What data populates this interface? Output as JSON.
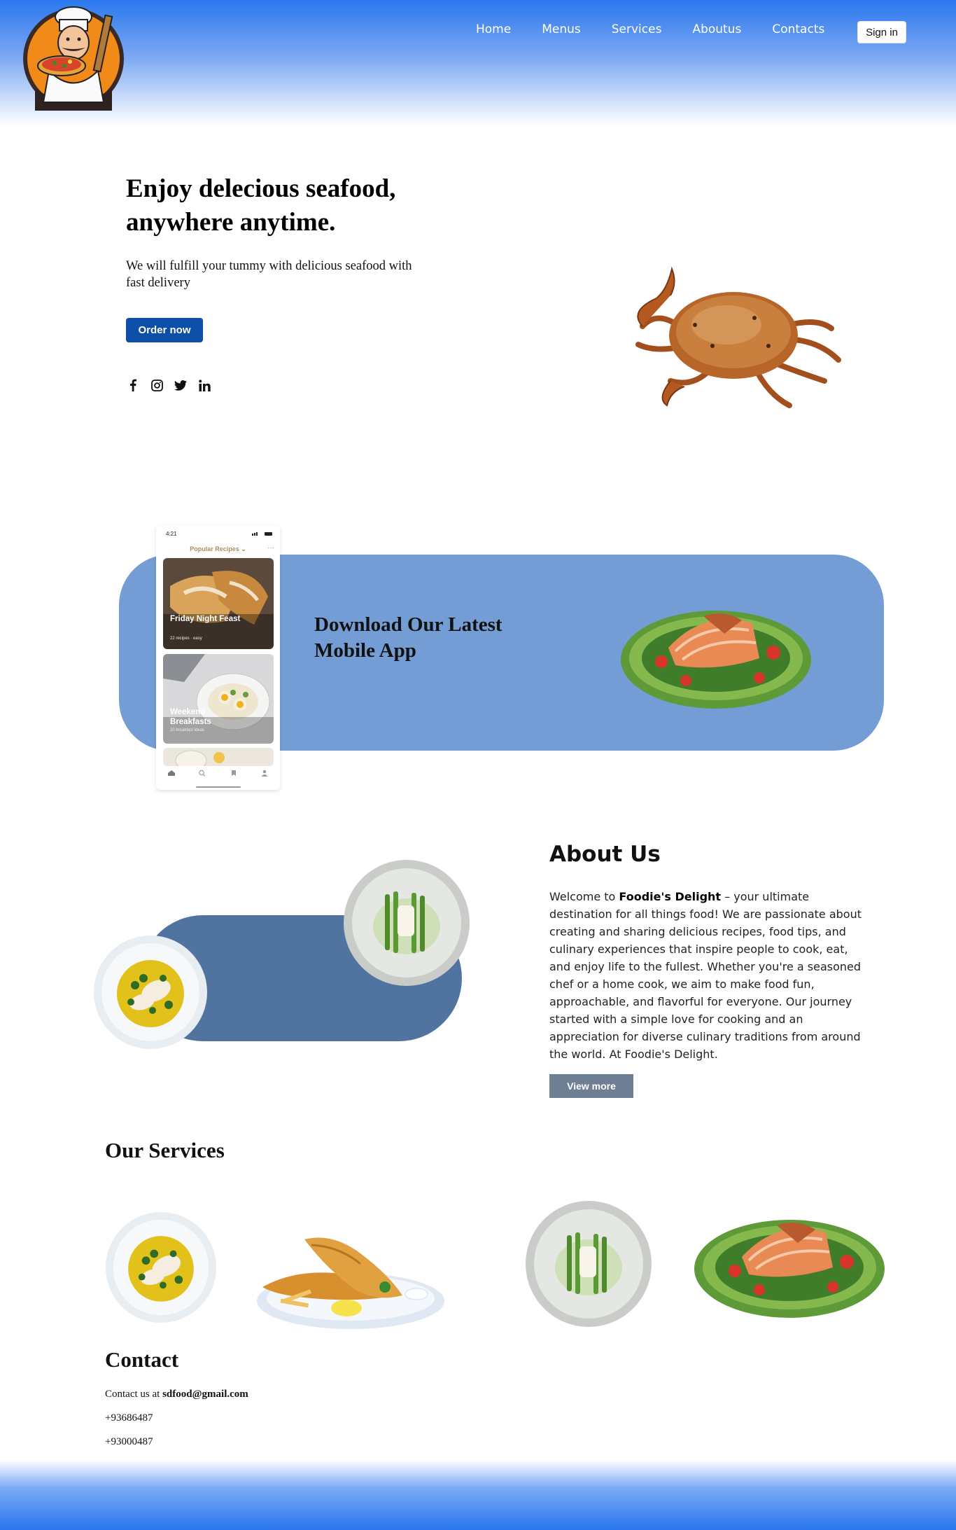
{
  "header": {
    "logo_icon": "chef-with-pizza-logo",
    "nav": [
      "Home",
      "Menus",
      "Services",
      "Aboutus",
      "Contacts"
    ],
    "sign_in": "Sign in"
  },
  "hero": {
    "title": "Enjoy delecious seafood, anywhere anytime.",
    "subtitle": "We will fulfill your tummy with delicious seafood with fast delivery",
    "cta": "Order now",
    "social_icons": [
      "facebook-icon",
      "instagram-icon",
      "twitter-icon",
      "linkedin-icon"
    ]
  },
  "app_banner": {
    "title": "Download Our Latest Mobile App",
    "phone": {
      "time": "4:21",
      "heading": "Popular Recipes",
      "cards": [
        {
          "label": "Friday Night Feast",
          "meta": "22 recipes · easy"
        },
        {
          "label": "Weekend Breakfasts",
          "meta": "20 breakfast ideas"
        }
      ]
    }
  },
  "about": {
    "title": "About Us",
    "text_prefix": "Welcome to ",
    "brand": "Foodie's Delight",
    "text_body": " – your ultimate destination for all things food! We are passionate about creating and sharing delicious recipes, food tips, and culinary experiences that inspire people to cook, eat, and enjoy life to the fullest. Whether you're a seasoned chef or a home cook, we aim to make food fun, approachable, and flavorful for everyone. Our journey started with a simple love for cooking and an appreciation for diverse culinary traditions from around the world. At Foodie's Delight.",
    "button": "View more"
  },
  "services": {
    "title": "Our Services"
  },
  "contact": {
    "title": "Contact",
    "email_prefix": "Contact us at ",
    "email": "sdfood@gmail.com",
    "phones": [
      "+93686487",
      "+93000487"
    ]
  },
  "colors": {
    "header_blue": "#2a78ee",
    "band_blue": "#739dd4",
    "about_blue": "#50739f",
    "order_button": "#0d4fa8",
    "view_button": "#6e7f93"
  }
}
